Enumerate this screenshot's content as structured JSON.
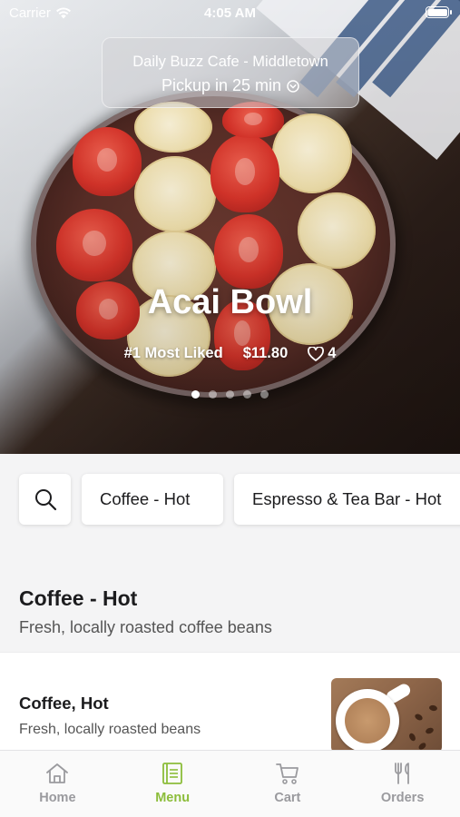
{
  "status_bar": {
    "carrier": "Carrier",
    "time": "4:05 AM"
  },
  "store": {
    "name": "Daily Buzz Cafe - Middletown",
    "pickup": "Pickup in 25 min"
  },
  "featured": {
    "title": "Acai Bowl",
    "badge": "#1 Most Liked",
    "price": "$11.80",
    "likes": "4",
    "carousel": {
      "total": 5,
      "active_index": 0
    }
  },
  "categories": [
    "Coffee - Hot",
    "Espresso & Tea Bar - Hot"
  ],
  "section": {
    "title": "Coffee - Hot",
    "subtitle": "Fresh, locally roasted coffee beans"
  },
  "items": [
    {
      "name": "Coffee, Hot",
      "description": "Fresh, locally roasted beans"
    }
  ],
  "tabs": [
    {
      "label": "Home",
      "icon": "home-icon",
      "active": false
    },
    {
      "label": "Menu",
      "icon": "menu-book-icon",
      "active": true
    },
    {
      "label": "Cart",
      "icon": "cart-icon",
      "active": false
    },
    {
      "label": "Orders",
      "icon": "fork-knife-icon",
      "active": false
    }
  ],
  "colors": {
    "accent": "#8cbd3a",
    "inactive_tab": "#9a9a9e",
    "background": "#f4f4f5"
  }
}
